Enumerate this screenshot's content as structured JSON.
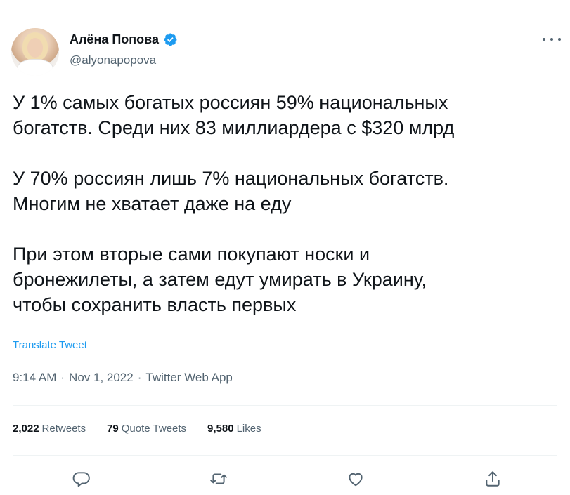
{
  "author": {
    "display_name": "Алёна Попова",
    "handle": "@alyonapopova",
    "verified": true
  },
  "tweet": {
    "paragraphs": [
      [
        "У 1% самых богатых россиян 59% национальных",
        "богатств. Среди них 83 миллиардера с $320 млрд"
      ],
      [
        "У 70% россиян лишь 7% национальных богатств.",
        "Многим не хватает даже на еду"
      ],
      [
        "При этом вторые сами покупают носки и",
        "бронежилеты, а затем едут умирать в Украину,",
        "чтобы сохранить власть первых"
      ]
    ],
    "translate_label": "Translate Tweet",
    "time": "9:14 AM",
    "date": "Nov 1, 2022",
    "source": "Twitter Web App",
    "separator": "·"
  },
  "stats": {
    "retweets": {
      "count": "2,022",
      "label": "Retweets"
    },
    "quotes": {
      "count": "79",
      "label": "Quote Tweets"
    },
    "likes": {
      "count": "9,580",
      "label": "Likes"
    }
  },
  "colors": {
    "accent": "#1d9bf0",
    "secondary_text": "#536471",
    "primary_text": "#0f1419",
    "divider": "#eff3f4"
  },
  "icons": [
    "verified-badge-icon",
    "more-icon",
    "reply-icon",
    "retweet-icon",
    "like-icon",
    "share-icon"
  ]
}
